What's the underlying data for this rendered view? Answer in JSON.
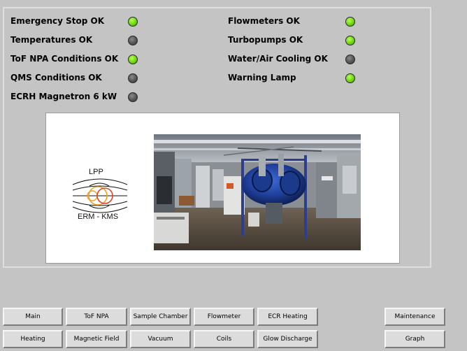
{
  "status": {
    "left": [
      {
        "label": "Emergency Stop OK",
        "state": "on"
      },
      {
        "label": "Temperatures OK",
        "state": "off"
      },
      {
        "label": "ToF NPA Conditions OK",
        "state": "on"
      },
      {
        "label": "QMS Conditions OK",
        "state": "off"
      },
      {
        "label": "ECRH Magnetron 6 kW",
        "state": "off"
      }
    ],
    "right": [
      {
        "label": "Flowmeters OK",
        "state": "on"
      },
      {
        "label": "Turbopumps OK",
        "state": "on"
      },
      {
        "label": "Water/Air Cooling OK",
        "state": "off"
      },
      {
        "label": "Warning Lamp",
        "state": "on"
      }
    ]
  },
  "logo": {
    "top_text": "LPP",
    "bottom_text": "ERM - KMS"
  },
  "colors": {
    "led_on": "#6ed60e",
    "led_off": "#555555",
    "background": "#c4c4c4"
  },
  "nav": {
    "main": "Main",
    "tof_npa": "ToF NPA",
    "sample_chamber": "Sample Chamber",
    "flowmeter": "Flowmeter",
    "ecr_heating": "ECR Heating",
    "maintenance": "Maintenance",
    "heating": "Heating",
    "magnetic_field": "Magnetic Field",
    "vacuum": "Vacuum",
    "coils": "Coils",
    "glow_discharge": "Glow Discharge",
    "graph": "Graph"
  }
}
